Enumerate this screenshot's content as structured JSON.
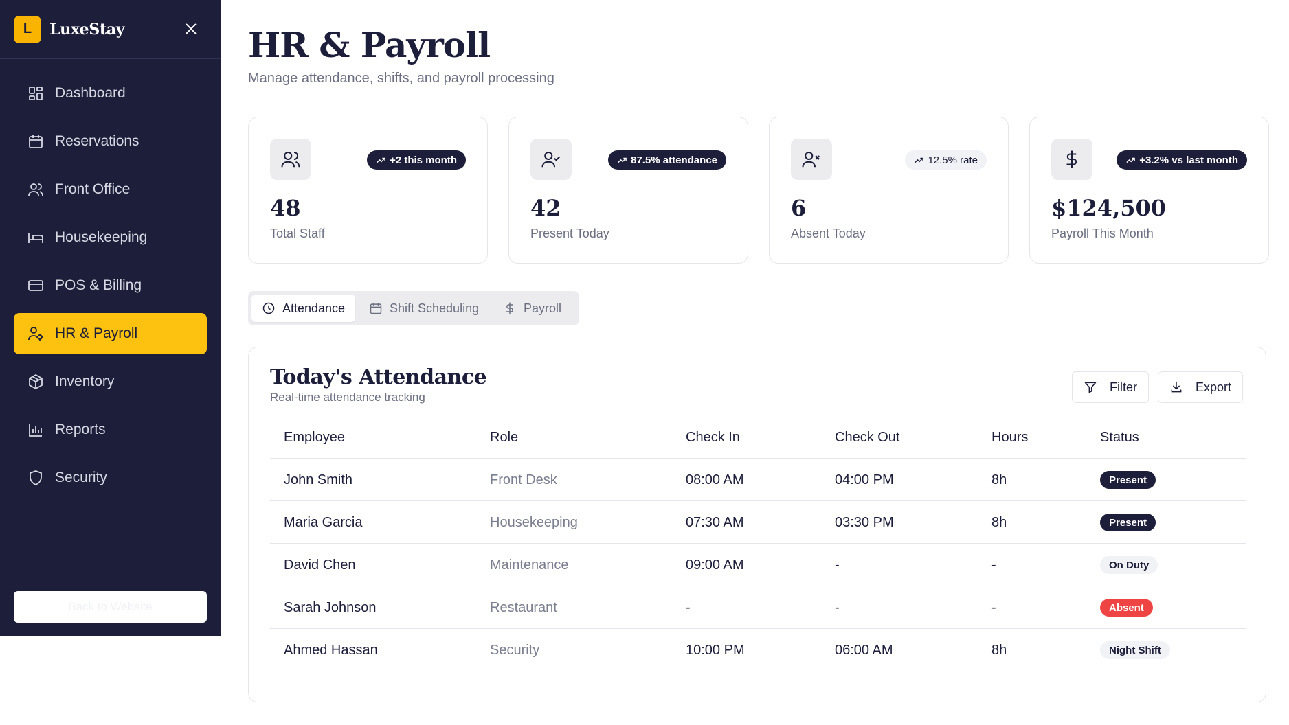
{
  "brand": {
    "logo_letter": "L",
    "name": "LuxeStay"
  },
  "sidebar": {
    "items": [
      {
        "label": "Dashboard",
        "icon": "dashboard-icon",
        "active": false
      },
      {
        "label": "Reservations",
        "icon": "calendar-icon",
        "active": false
      },
      {
        "label": "Front Office",
        "icon": "users-icon",
        "active": false
      },
      {
        "label": "Housekeeping",
        "icon": "bed-icon",
        "active": false
      },
      {
        "label": "POS & Billing",
        "icon": "credit-card-icon",
        "active": false
      },
      {
        "label": "HR & Payroll",
        "icon": "user-cog-icon",
        "active": true
      },
      {
        "label": "Inventory",
        "icon": "package-icon",
        "active": false
      },
      {
        "label": "Reports",
        "icon": "bar-chart-icon",
        "active": false
      },
      {
        "label": "Security",
        "icon": "shield-icon",
        "active": false
      }
    ],
    "back_label": "Back to Website"
  },
  "header": {
    "title": "HR & Payroll",
    "subtitle": "Manage attendance, shifts, and payroll processing"
  },
  "stats": [
    {
      "value": "48",
      "label": "Total Staff",
      "badge": "+2 this month",
      "icon": "users-icon"
    },
    {
      "value": "42",
      "label": "Present Today",
      "badge": "87.5% attendance",
      "icon": "user-check-icon"
    },
    {
      "value": "6",
      "label": "Absent Today",
      "badge": "12.5% rate",
      "icon": "user-x-icon"
    },
    {
      "value": "$124,500",
      "label": "Payroll This Month",
      "badge": "+3.2% vs last month",
      "icon": "dollar-icon"
    }
  ],
  "tabs": [
    {
      "label": "Attendance",
      "icon": "clock-icon",
      "active": true
    },
    {
      "label": "Shift Scheduling",
      "icon": "calendar-icon",
      "active": false
    },
    {
      "label": "Payroll",
      "icon": "dollar-icon",
      "active": false
    }
  ],
  "attendance": {
    "title": "Today's Attendance",
    "subtitle": "Real-time attendance tracking",
    "filter_label": "Filter",
    "export_label": "Export",
    "columns": [
      "Employee",
      "Role",
      "Check In",
      "Check Out",
      "Hours",
      "Status"
    ],
    "rows": [
      {
        "employee": "John Smith",
        "role": "Front Desk",
        "check_in": "08:00 AM",
        "check_out": "04:00 PM",
        "hours": "8h",
        "status": "Present"
      },
      {
        "employee": "Maria Garcia",
        "role": "Housekeeping",
        "check_in": "07:30 AM",
        "check_out": "03:30 PM",
        "hours": "8h",
        "status": "Present"
      },
      {
        "employee": "David Chen",
        "role": "Maintenance",
        "check_in": "09:00 AM",
        "check_out": "-",
        "hours": "-",
        "status": "On Duty"
      },
      {
        "employee": "Sarah Johnson",
        "role": "Restaurant",
        "check_in": "-",
        "check_out": "-",
        "hours": "-",
        "status": "Absent"
      },
      {
        "employee": "Ahmed Hassan",
        "role": "Security",
        "check_in": "10:00 PM",
        "check_out": "06:00 AM",
        "hours": "8h",
        "status": "Night Shift"
      }
    ]
  },
  "colors": {
    "sidebar_bg": "#1c1e3a",
    "accent": "#fdc20f",
    "absent": "#ef4444"
  }
}
